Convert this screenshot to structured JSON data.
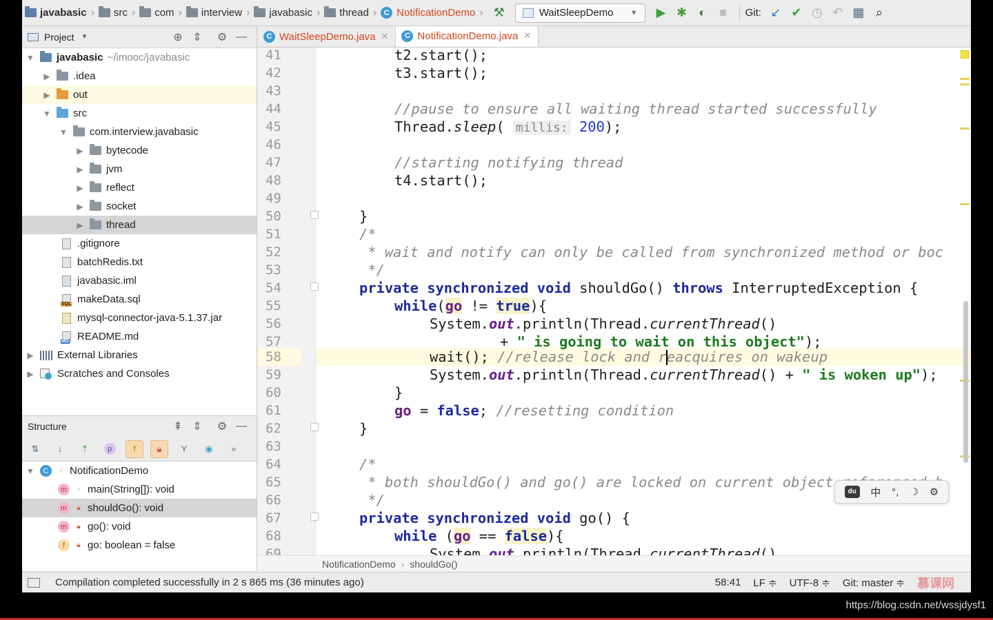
{
  "navbar": {
    "crumbs": [
      "javabasic",
      "src",
      "com",
      "interview",
      "javabasic",
      "thread",
      "NotificationDemo"
    ],
    "run_config": "WaitSleepDemo",
    "git_label": "Git:"
  },
  "project_panel": {
    "title": "Project",
    "tree": [
      {
        "label": "javabasic",
        "extra": "~/imooc/javabasic"
      },
      {
        "label": ".idea"
      },
      {
        "label": "out"
      },
      {
        "label": "src"
      },
      {
        "label": "com.interview.javabasic"
      },
      {
        "label": "bytecode"
      },
      {
        "label": "jvm"
      },
      {
        "label": "reflect"
      },
      {
        "label": "socket"
      },
      {
        "label": "thread"
      },
      {
        "label": ".gitignore"
      },
      {
        "label": "batchRedis.txt"
      },
      {
        "label": "javabasic.iml"
      },
      {
        "label": "makeData.sql"
      },
      {
        "label": "mysql-connector-java-5.1.37.jar"
      },
      {
        "label": "README.md"
      },
      {
        "label": "External Libraries"
      },
      {
        "label": "Scratches and Consoles"
      }
    ]
  },
  "structure_panel": {
    "title": "Structure",
    "items": [
      {
        "label": "NotificationDemo"
      },
      {
        "label": "main(String[]): void"
      },
      {
        "label": "shouldGo(): void"
      },
      {
        "label": "go(): void"
      },
      {
        "label": "go: boolean = false"
      }
    ]
  },
  "tabs": [
    {
      "label": "WaitSleepDemo.java"
    },
    {
      "label": "NotificationDemo.java"
    }
  ],
  "editor": {
    "line_numbers": [
      "41",
      "42",
      "43",
      "44",
      "45",
      "46",
      "47",
      "48",
      "49",
      "50",
      "51",
      "52",
      "53",
      "54",
      "55",
      "56",
      "57",
      "58",
      "59",
      "60",
      "61",
      "62",
      "63",
      "64",
      "65",
      "66",
      "67",
      "68",
      "69"
    ],
    "current_line": "58",
    "param_hint": "millis:",
    "breadcrumb": [
      "NotificationDemo",
      "shouldGo()"
    ]
  },
  "ime": {
    "logo": "du",
    "items": [
      "中",
      "°,",
      "☽",
      "⚙"
    ]
  },
  "statusbar": {
    "message": "Compilation completed successfully in 2 s 865 ms (36 minutes ago)",
    "position": "58:41",
    "line_sep": "LF ≑",
    "encoding": "UTF-8 ≑",
    "git_branch": "Git: master ≑",
    "watermark": "慕课网"
  },
  "footer_url": "https://blog.csdn.net/wssjdysf1"
}
